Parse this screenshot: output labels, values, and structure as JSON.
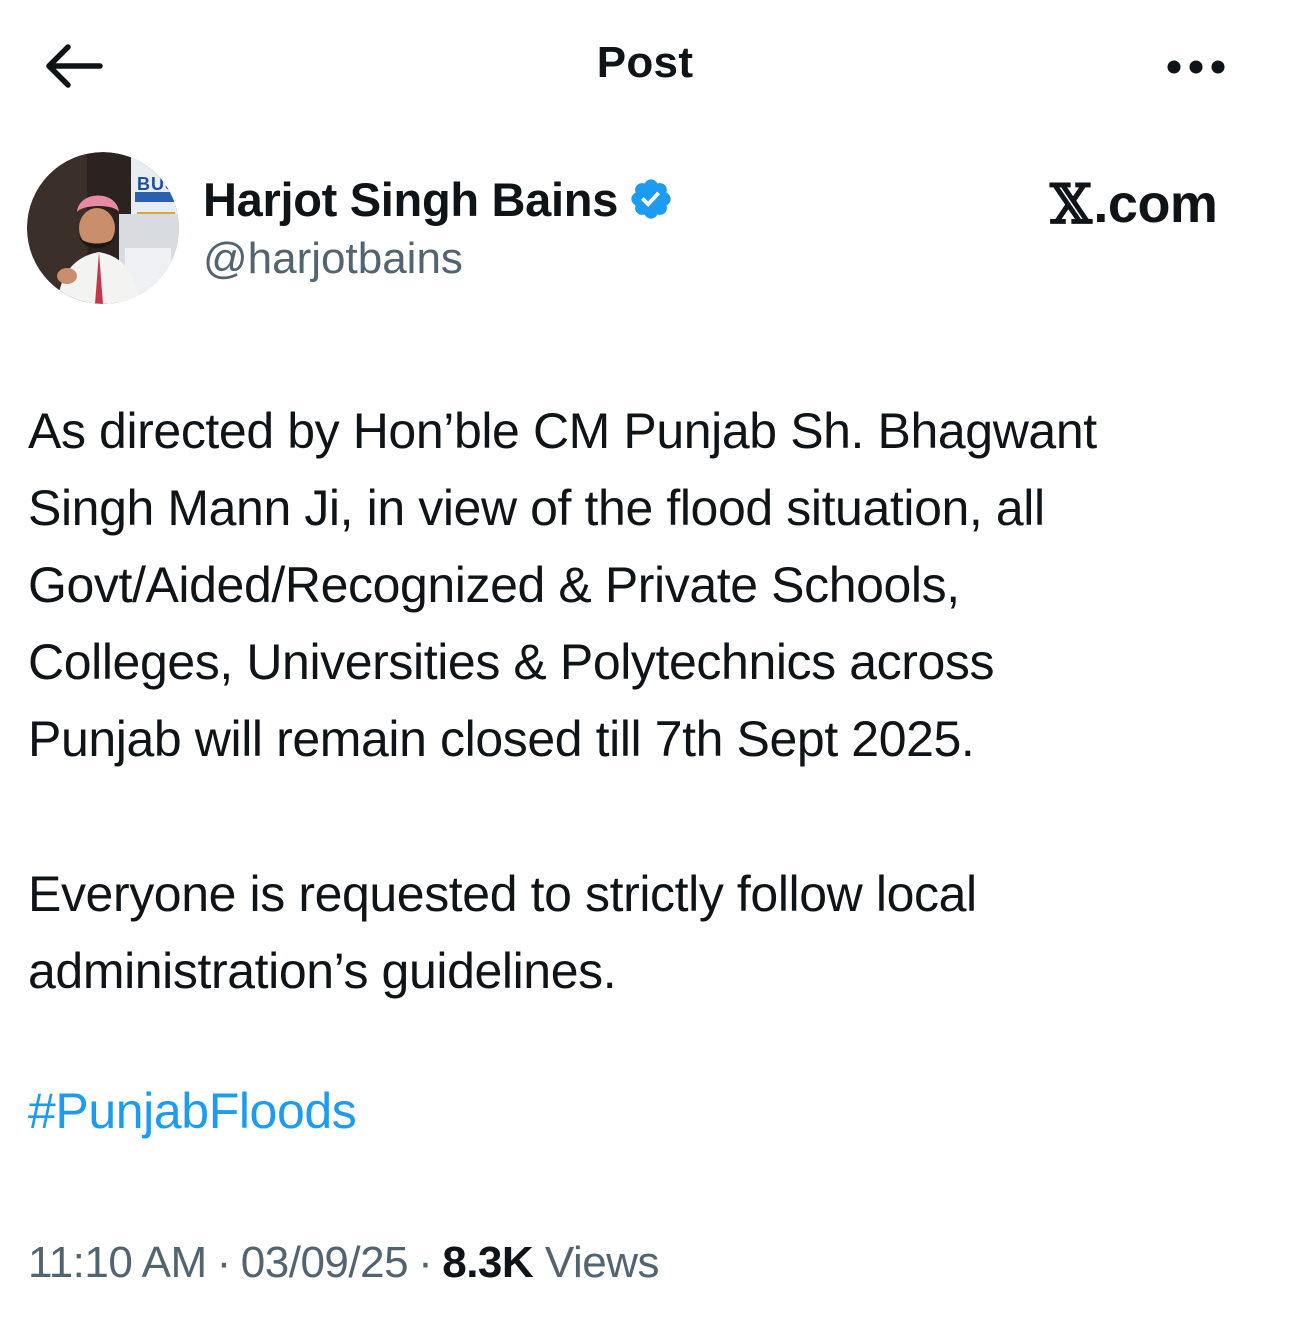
{
  "header": {
    "title": "Post",
    "back_icon": "arrow-left-icon",
    "more_icon": "more-horizontal-icon"
  },
  "author": {
    "display_name": "Harjot Singh Bains",
    "handle": "@harjotbains",
    "verified_icon": "verified-badge-icon",
    "verified_color": "#1d9bf0",
    "avatar_text": "BUS"
  },
  "brand": {
    "x_glyph": "𝕏",
    "suffix": ".com"
  },
  "post": {
    "paragraph1_lines": [
      "As directed by Hon’ble CM Punjab Sh. Bhagwant",
      "Singh Mann Ji, in view of the flood situation, all",
      "Govt/Aided/Recognized & Private Schools,",
      "Colleges, Universities & Polytechnics across",
      "Punjab will remain closed till 7th Sept 2025."
    ],
    "paragraph2_lines": [
      "Everyone is requested to strictly follow local",
      "administration’s guidelines."
    ],
    "hashtag": "#PunjabFloods",
    "hashtag_color": "#1d9bf0"
  },
  "meta": {
    "time": "11:10 AM",
    "separator": "·",
    "date": "03/09/25",
    "views_count": "8.3K",
    "views_label": "Views"
  },
  "colors": {
    "text_primary": "#0f1419",
    "text_secondary": "#536471",
    "accent": "#1d9bf0",
    "background": "#ffffff"
  }
}
